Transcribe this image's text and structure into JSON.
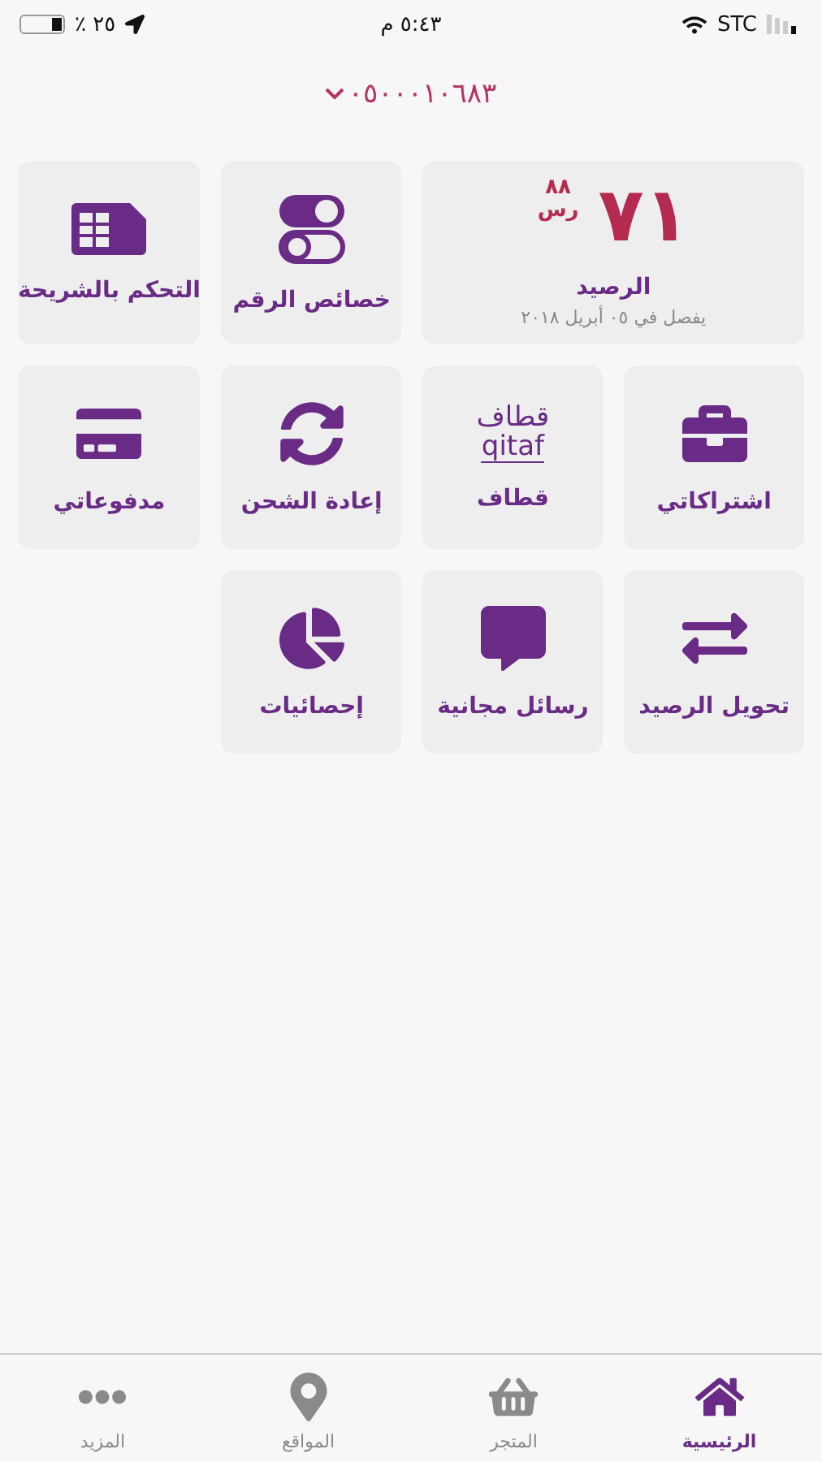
{
  "status_bar": {
    "battery": "٪ ٢٥",
    "time": "٥:٤٣ م",
    "carrier": "STC"
  },
  "phone_number": "٠٥٠٠٠١٠٦٨٣",
  "balance": {
    "amount": "٧١",
    "fraction": "٨٨",
    "currency": "رس",
    "label": "الرصيد",
    "expiry": "يفصل في ٠٥ أبريل ٢٠١٨"
  },
  "tiles": [
    {
      "kind": "icon",
      "label": "خصائص الرقم"
    },
    {
      "kind": "icon",
      "label": "التحكم بالشريحة"
    },
    {
      "kind": "icon",
      "label": "اشتراكاتي"
    },
    {
      "kind": "logo",
      "label": "قطاف",
      "logo_text": [
        "قطاف",
        "qitaf"
      ]
    },
    {
      "kind": "icon",
      "label": "إعادة الشحن"
    },
    {
      "kind": "icon",
      "label": "مدفوعاتي"
    },
    {
      "kind": "icon",
      "label": "تحويل الرصيد"
    },
    {
      "kind": "icon",
      "label": "رسائل مجانية"
    },
    {
      "kind": "icon",
      "label": "إحصائيات"
    }
  ],
  "tab_bar": [
    {
      "label": "الرئيسية",
      "selected": true
    },
    {
      "label": "المتجر",
      "selected": false
    },
    {
      "label": "المواقع",
      "selected": false
    },
    {
      "label": "المزيد",
      "selected": false
    }
  ]
}
